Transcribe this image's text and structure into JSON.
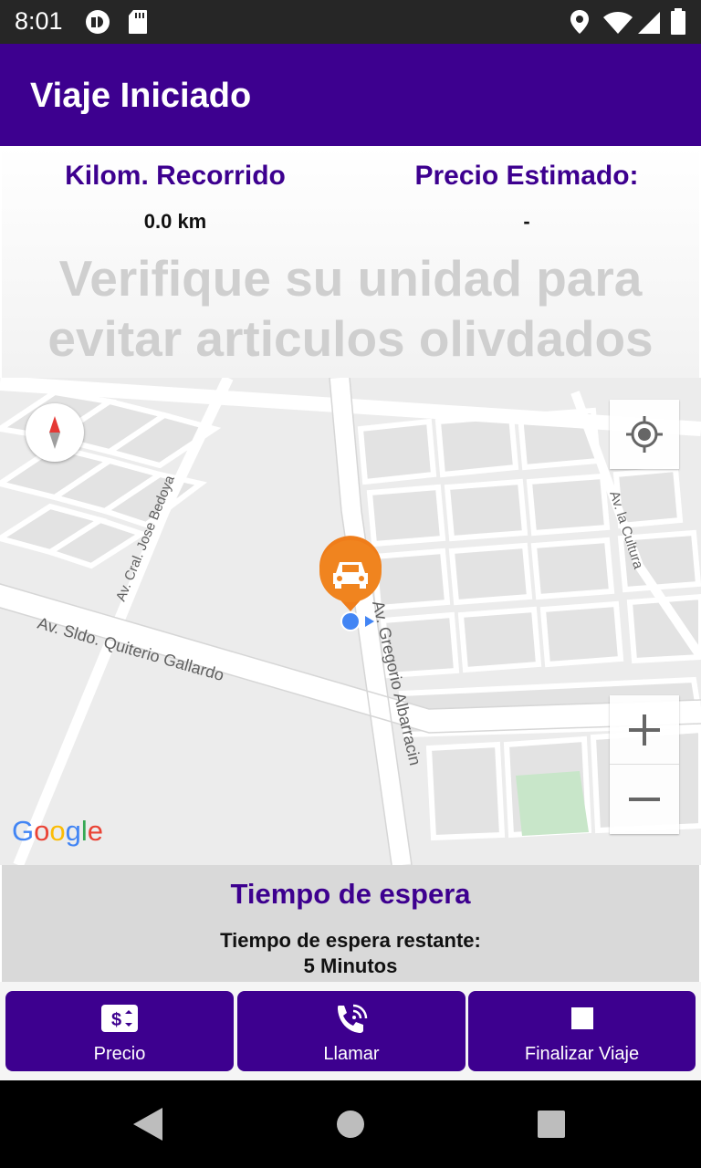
{
  "status_bar": {
    "time": "8:01",
    "icons": [
      "notification-badge-icon",
      "sd-card-icon",
      "location-icon",
      "wifi-icon",
      "cell-signal-icon",
      "battery-icon"
    ]
  },
  "app_bar": {
    "title": "Viaje Iniciado"
  },
  "trip_info": {
    "distance_label": "Kilom. Recorrido",
    "distance_value": "0.0 km",
    "price_label": "Precio Estimado:",
    "price_value": "-",
    "warning_text": "Verifique su unidad para evitar articulos olivdados"
  },
  "map": {
    "streets": [
      "Av. Sldo. Quiterio Gallardo",
      "Av. Gregorio Albarracin",
      "Av. Cral. Jose Bedoya",
      "Av. la Cultura"
    ],
    "provider": "Google",
    "zoom_in_label": "+",
    "zoom_out_label": "−",
    "icons": [
      "compass-icon",
      "my-location-icon",
      "car-marker-icon",
      "current-location-dot-icon"
    ]
  },
  "wait": {
    "title": "Tiempo de espera",
    "remaining_label": "Tiempo de espera restante:",
    "remaining_value": "5 Minutos"
  },
  "actions": [
    {
      "label": "Precio",
      "icon": "price-icon"
    },
    {
      "label": "Llamar",
      "icon": "phone-call-icon"
    },
    {
      "label": "Finalizar Viaje",
      "icon": "stop-icon"
    }
  ],
  "colors": {
    "primary": "#3d008f",
    "status_bar": "#262626",
    "marker": "#ef7d1a",
    "location_dot": "#4285f4"
  }
}
